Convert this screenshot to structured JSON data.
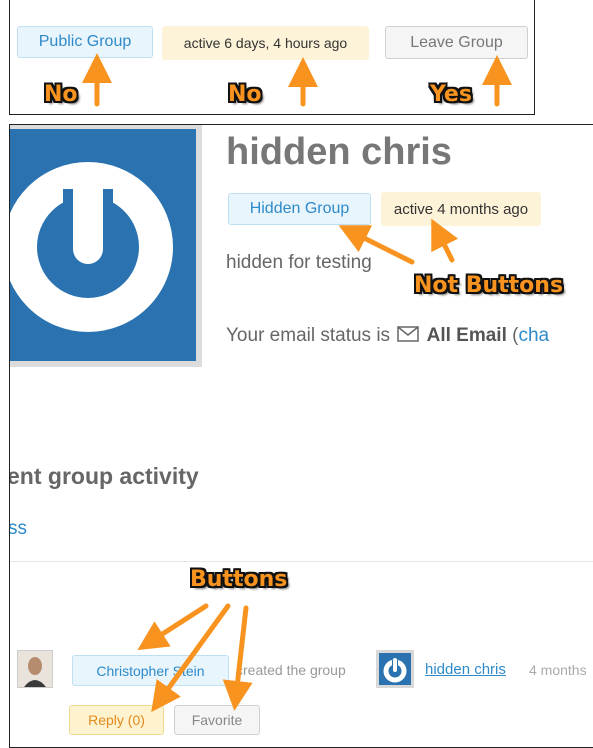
{
  "top_panel": {
    "public_group_badge": "Public Group",
    "active_badge": "active 6 days, 4 hours ago",
    "leave_group_button": "Leave Group",
    "label_no_1": "No",
    "label_no_2": "No",
    "label_yes": "Yes"
  },
  "group_header": {
    "title": "hidden chris",
    "hidden_group_badge": "Hidden Group",
    "active_badge": "active 4 months ago",
    "description": "hidden for testing",
    "email_status_prefix": "Your email status is",
    "email_status_value": "All Email",
    "email_change_link": "cha",
    "not_buttons_label": "Not Buttons"
  },
  "activity": {
    "heading": "ent group activity",
    "rss_link": "ss",
    "buttons_label": "Buttons",
    "item": {
      "user_name": "Christopher Stein",
      "action_text": "created the group",
      "group_link": "hidden chris",
      "time": "4 months",
      "reply_button": "Reply (0)",
      "favorite_button": "Favorite"
    }
  },
  "colors": {
    "annotation_orange": "#f7931e",
    "link_blue": "#2e8ac9",
    "group_avatar_blue": "#2a73b0"
  }
}
